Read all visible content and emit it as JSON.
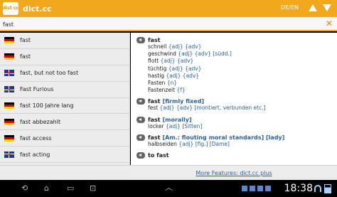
{
  "app": {
    "title": "dict.cc",
    "icon_text": "dict cc",
    "lang_pair": "DE/EN"
  },
  "search": {
    "value": "fast",
    "placeholder": ""
  },
  "results_list": [
    {
      "flag": "de",
      "label": "fast"
    },
    {
      "flag": "de",
      "label": "fast"
    },
    {
      "flag": "uk",
      "label": "fast, but not too fast"
    },
    {
      "flag": "uk",
      "label": "Fast  Furious"
    },
    {
      "flag": "de",
      "label": "fast 100 Jahre lang"
    },
    {
      "flag": "de",
      "label": "fast abbezahlt"
    },
    {
      "flag": "de",
      "label": "fast access"
    },
    {
      "flag": "uk",
      "label": "fast acting"
    }
  ],
  "entries": [
    {
      "head": "fast",
      "qualifier": "",
      "translations": [
        {
          "word": "schnell",
          "tag": "{adj} {adv}"
        },
        {
          "word": "geschwind",
          "tag": "{adj} {adv} [südd.]"
        },
        {
          "word": "flott",
          "tag": "{adj} {adv}"
        },
        {
          "word": "tüchtig",
          "tag": "{adj} {adv}"
        },
        {
          "word": "hastig",
          "tag": "{adj} {adv}"
        },
        {
          "word": "Fasten",
          "tag": "{n}"
        },
        {
          "word": "Fastenzeit",
          "tag": "{f}"
        }
      ]
    },
    {
      "head": "fast",
      "qualifier": "[firmly fixed]",
      "translations": [
        {
          "word": "fest",
          "tag": "{adj} {adv} [montiert, verbunden etc.]"
        }
      ]
    },
    {
      "head": "fast",
      "qualifier": "[morally]",
      "translations": [
        {
          "word": "locker",
          "tag": "{adj} [Sitten]"
        }
      ]
    },
    {
      "head": "fast",
      "qualifier": "[Am.: flouting moral standards] [lady]",
      "translations": [
        {
          "word": "halbseiden",
          "tag": "{adj} [fig.] [Dame]"
        }
      ]
    },
    {
      "head": "to fast",
      "qualifier": "",
      "translations": []
    }
  ],
  "more_features": "More Features: dict.cc plus",
  "statusbar": {
    "clock": "18:38"
  },
  "colors": {
    "accent": "#f2a81c",
    "link": "#2a5fa0"
  }
}
